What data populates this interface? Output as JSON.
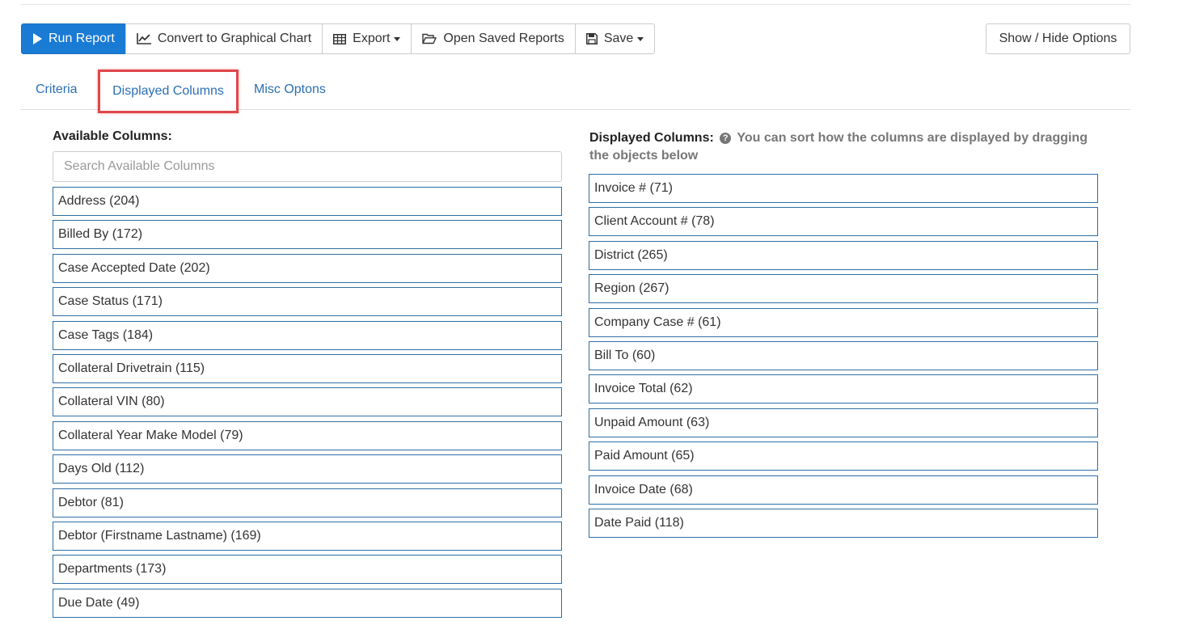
{
  "toolbar": {
    "run_report": "Run Report",
    "convert_chart": "Convert to Graphical Chart",
    "export": "Export",
    "open_saved": "Open Saved Reports",
    "save": "Save",
    "show_hide": "Show / Hide Options"
  },
  "icons": {
    "run_report": "play-icon",
    "convert_chart": "line-chart-icon",
    "export": "table-icon",
    "open_saved": "folder-open-icon",
    "save": "floppy-disk-icon",
    "help": "question-circle-icon"
  },
  "colors": {
    "primary": "#1a7bd5",
    "link": "#2a6fb5",
    "highlight": "#e0474a",
    "item_border": "#2f6fa6"
  },
  "tabs": [
    {
      "label": "Criteria",
      "active": false
    },
    {
      "label": "Displayed Columns",
      "active": true
    },
    {
      "label": "Misc Optons",
      "active": false
    }
  ],
  "available": {
    "label": "Available Columns:",
    "search_placeholder": "Search Available Columns",
    "items": [
      "Address (204)",
      "Billed By (172)",
      "Case Accepted Date (202)",
      "Case Status (171)",
      "Case Tags (184)",
      "Collateral Drivetrain (115)",
      "Collateral VIN (80)",
      "Collateral Year Make Model (79)",
      "Days Old (112)",
      "Debtor (81)",
      "Debtor (Firstname Lastname) (169)",
      "Departments (173)",
      "Due Date (49)"
    ]
  },
  "displayed": {
    "label": "Displayed Columns:",
    "hint": "You can sort how the columns are displayed by dragging the objects below",
    "items": [
      "Invoice # (71)",
      "Client Account # (78)",
      "District (265)",
      "Region (267)",
      "Company Case # (61)",
      "Bill To (60)",
      "Invoice Total (62)",
      "Unpaid Amount (63)",
      "Paid Amount (65)",
      "Invoice Date (68)",
      "Date Paid (118)"
    ]
  }
}
